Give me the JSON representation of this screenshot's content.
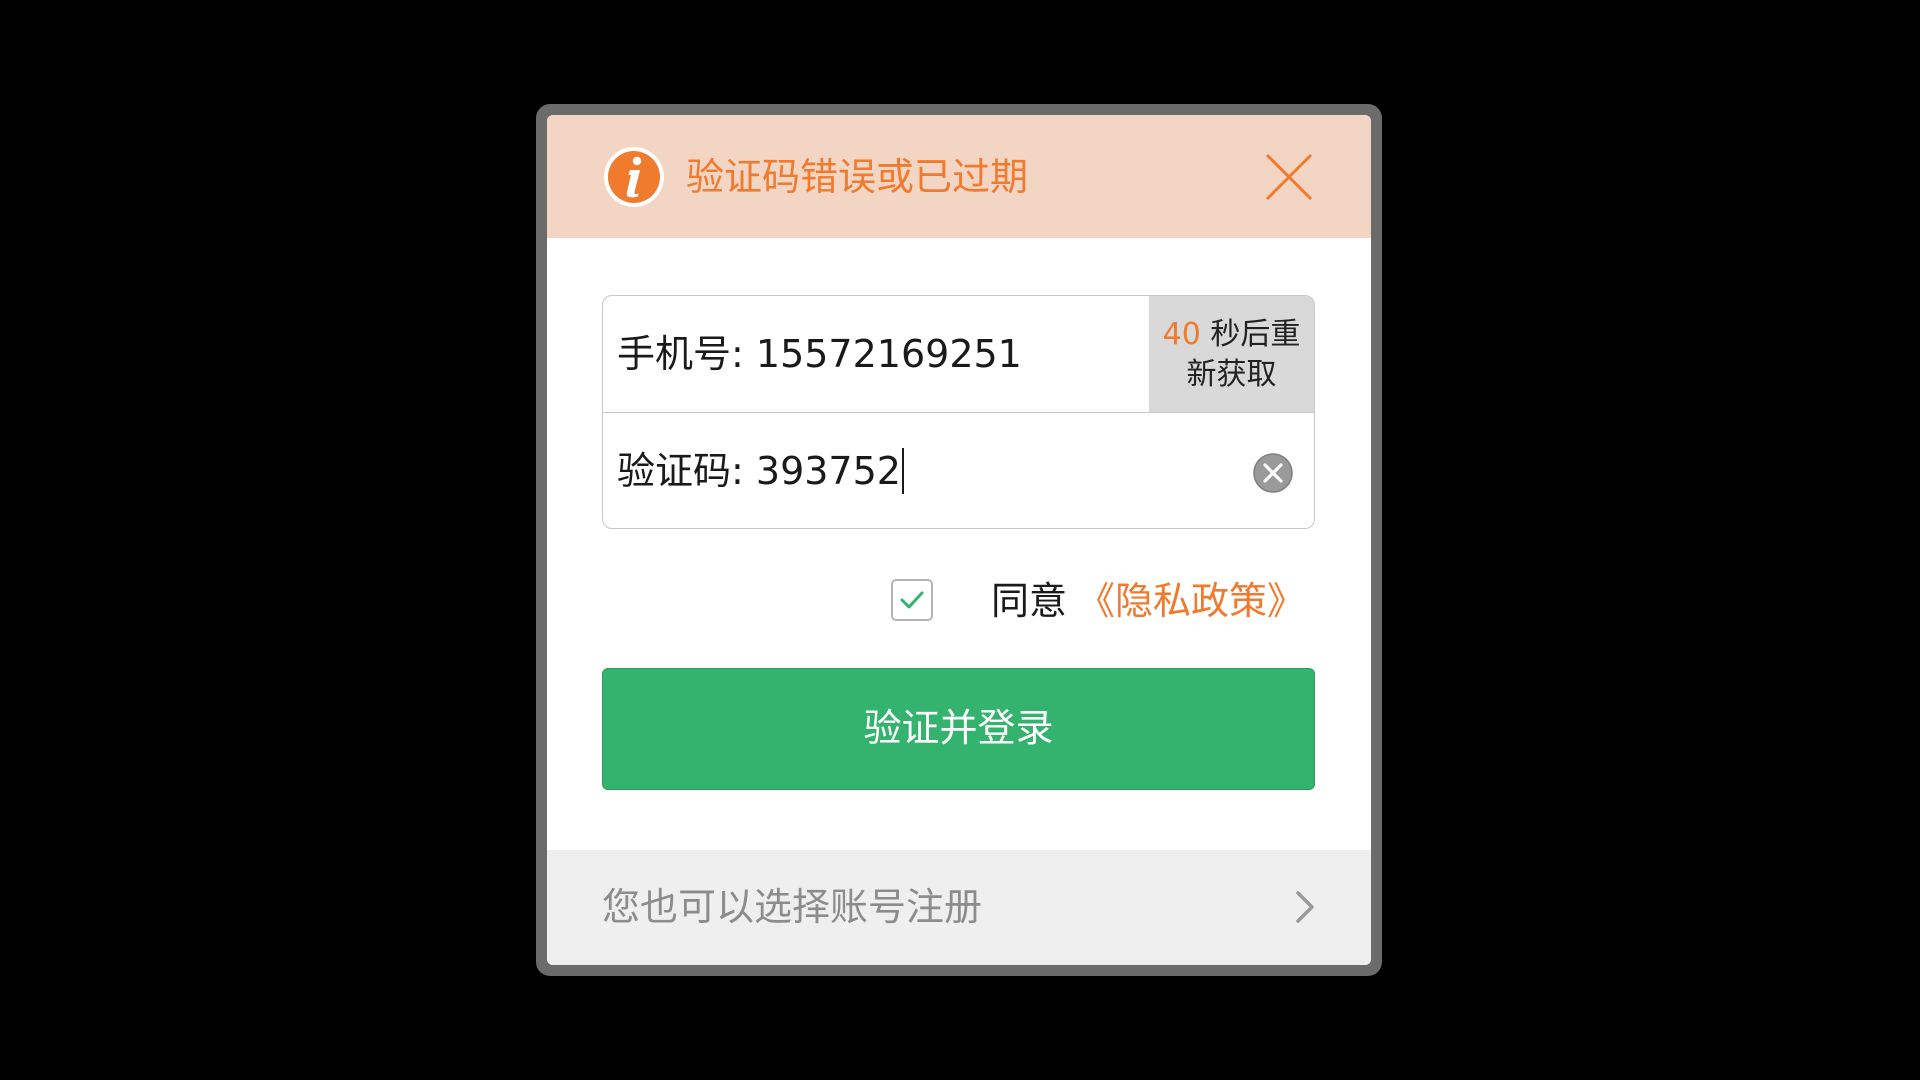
{
  "dialog": {
    "error_message": "验证码错误或已过期",
    "phone": {
      "label": "手机号:",
      "value": "15572169251"
    },
    "resend": {
      "countdown": "40",
      "suffix_line1": "秒后重",
      "line2": "新获取"
    },
    "code": {
      "label": "验证码:",
      "value": "393752"
    },
    "agree": {
      "checked": true,
      "text": "同意",
      "policy_link": "《隐私政策》"
    },
    "submit_label": "验证并登录",
    "register_text": "您也可以选择账号注册"
  },
  "colors": {
    "accent_orange": "#f07b2f",
    "banner_bg": "#f3d5c4",
    "primary_green": "#33b36d",
    "resend_bg": "#d9d9d9"
  },
  "icons": [
    "info-icon",
    "close-icon",
    "clear-icon",
    "checkmark-icon",
    "chevron-right-icon"
  ]
}
